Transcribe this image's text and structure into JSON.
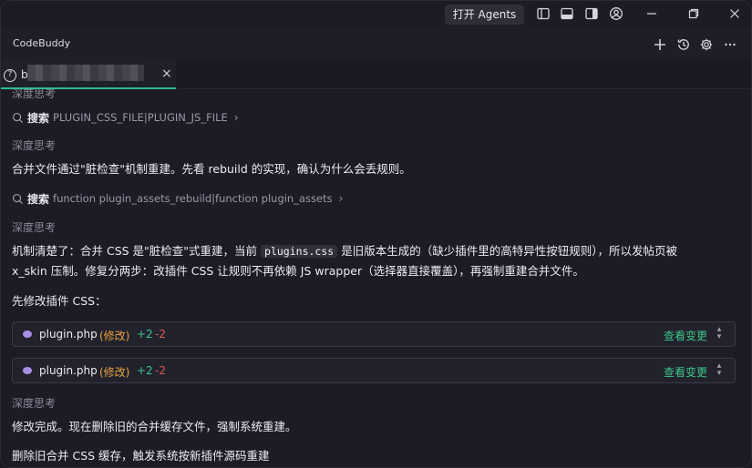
{
  "titlebar": {
    "agents_button": "打开 Agents"
  },
  "header": {
    "title": "CodeBuddy"
  },
  "tab": {
    "title": "b",
    "close": "×"
  },
  "content": {
    "think_top": "深度思考",
    "search1": {
      "label": "搜索",
      "query": "PLUGIN_CSS_FILE|PLUGIN_JS_FILE"
    },
    "think1": "深度思考",
    "para1": "合并文件通过\"脏检查\"机制重建。先看 rebuild 的实现，确认为什么会丢规则。",
    "search2": {
      "label": "搜索",
      "query": "function plugin_assets_rebuild|function plugin_assets"
    },
    "think2": "深度思考",
    "para2a": "机制清楚了：合并 CSS 是\"脏检查\"式重建，当前",
    "para2_code": "plugins.css",
    "para2b": "是旧版本生成的（缺少插件里的高特异性按钮规则），所以发帖页被",
    "para2c": "x_skin 压制。修复分两步：改插件 CSS 让规则不再依赖 JS wrapper（选择器直接覆盖），再强制重建合并文件。",
    "para3": "先修改插件 CSS：",
    "files": [
      {
        "name": "plugin.php",
        "status": "(修改)",
        "added": "+2",
        "removed": "-2",
        "view": "查看变更"
      },
      {
        "name": "plugin.php",
        "status": "(修改)",
        "added": "+2",
        "removed": "-2",
        "view": "查看变更"
      }
    ],
    "think3": "深度思考",
    "para4": "修改完成。现在删除旧的合并缓存文件，强制系统重建。",
    "para5": "删除旧合并 CSS 缓存，触发系统按新插件源码重建"
  },
  "colors": {
    "accent_green": "#2fbf8f",
    "modified_orange": "#e8a33d",
    "removed_red": "#e2575a"
  }
}
